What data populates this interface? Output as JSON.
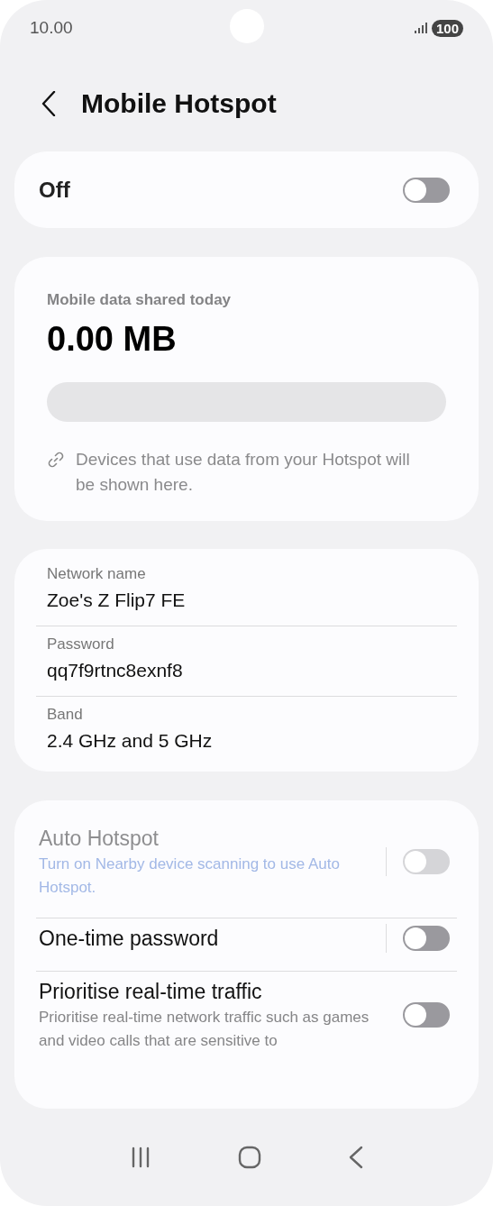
{
  "status_bar": {
    "time": "10.00",
    "battery": "100"
  },
  "header": {
    "title": "Mobile Hotspot"
  },
  "master": {
    "label": "Off",
    "on": false
  },
  "usage": {
    "label": "Mobile data shared today",
    "amount": "0.00 MB",
    "level": 0,
    "note": "Devices that use data from your Hotspot will be shown here."
  },
  "network": [
    {
      "label": "Network name",
      "value": "Zoe's Z Flip7 FE"
    },
    {
      "label": "Password",
      "value": "qq7f9rtnc8exnf8"
    },
    {
      "label": "Band",
      "value": "2.4 GHz and 5 GHz"
    }
  ],
  "options": [
    {
      "title": "Auto Hotspot",
      "subtitle": "Turn on Nearby device scanning to use Auto Hotspot.",
      "kind": "hint",
      "divider": true,
      "disabled": true,
      "on": false
    },
    {
      "title": "One-time password",
      "divider": true,
      "disabled": false,
      "on": false
    },
    {
      "title": "Prioritise real-time traffic",
      "subtitle": "Prioritise real-time network traffic such as games and video calls that are sensitive to",
      "kind": "description",
      "divider": false,
      "disabled": false,
      "on": false
    }
  ]
}
